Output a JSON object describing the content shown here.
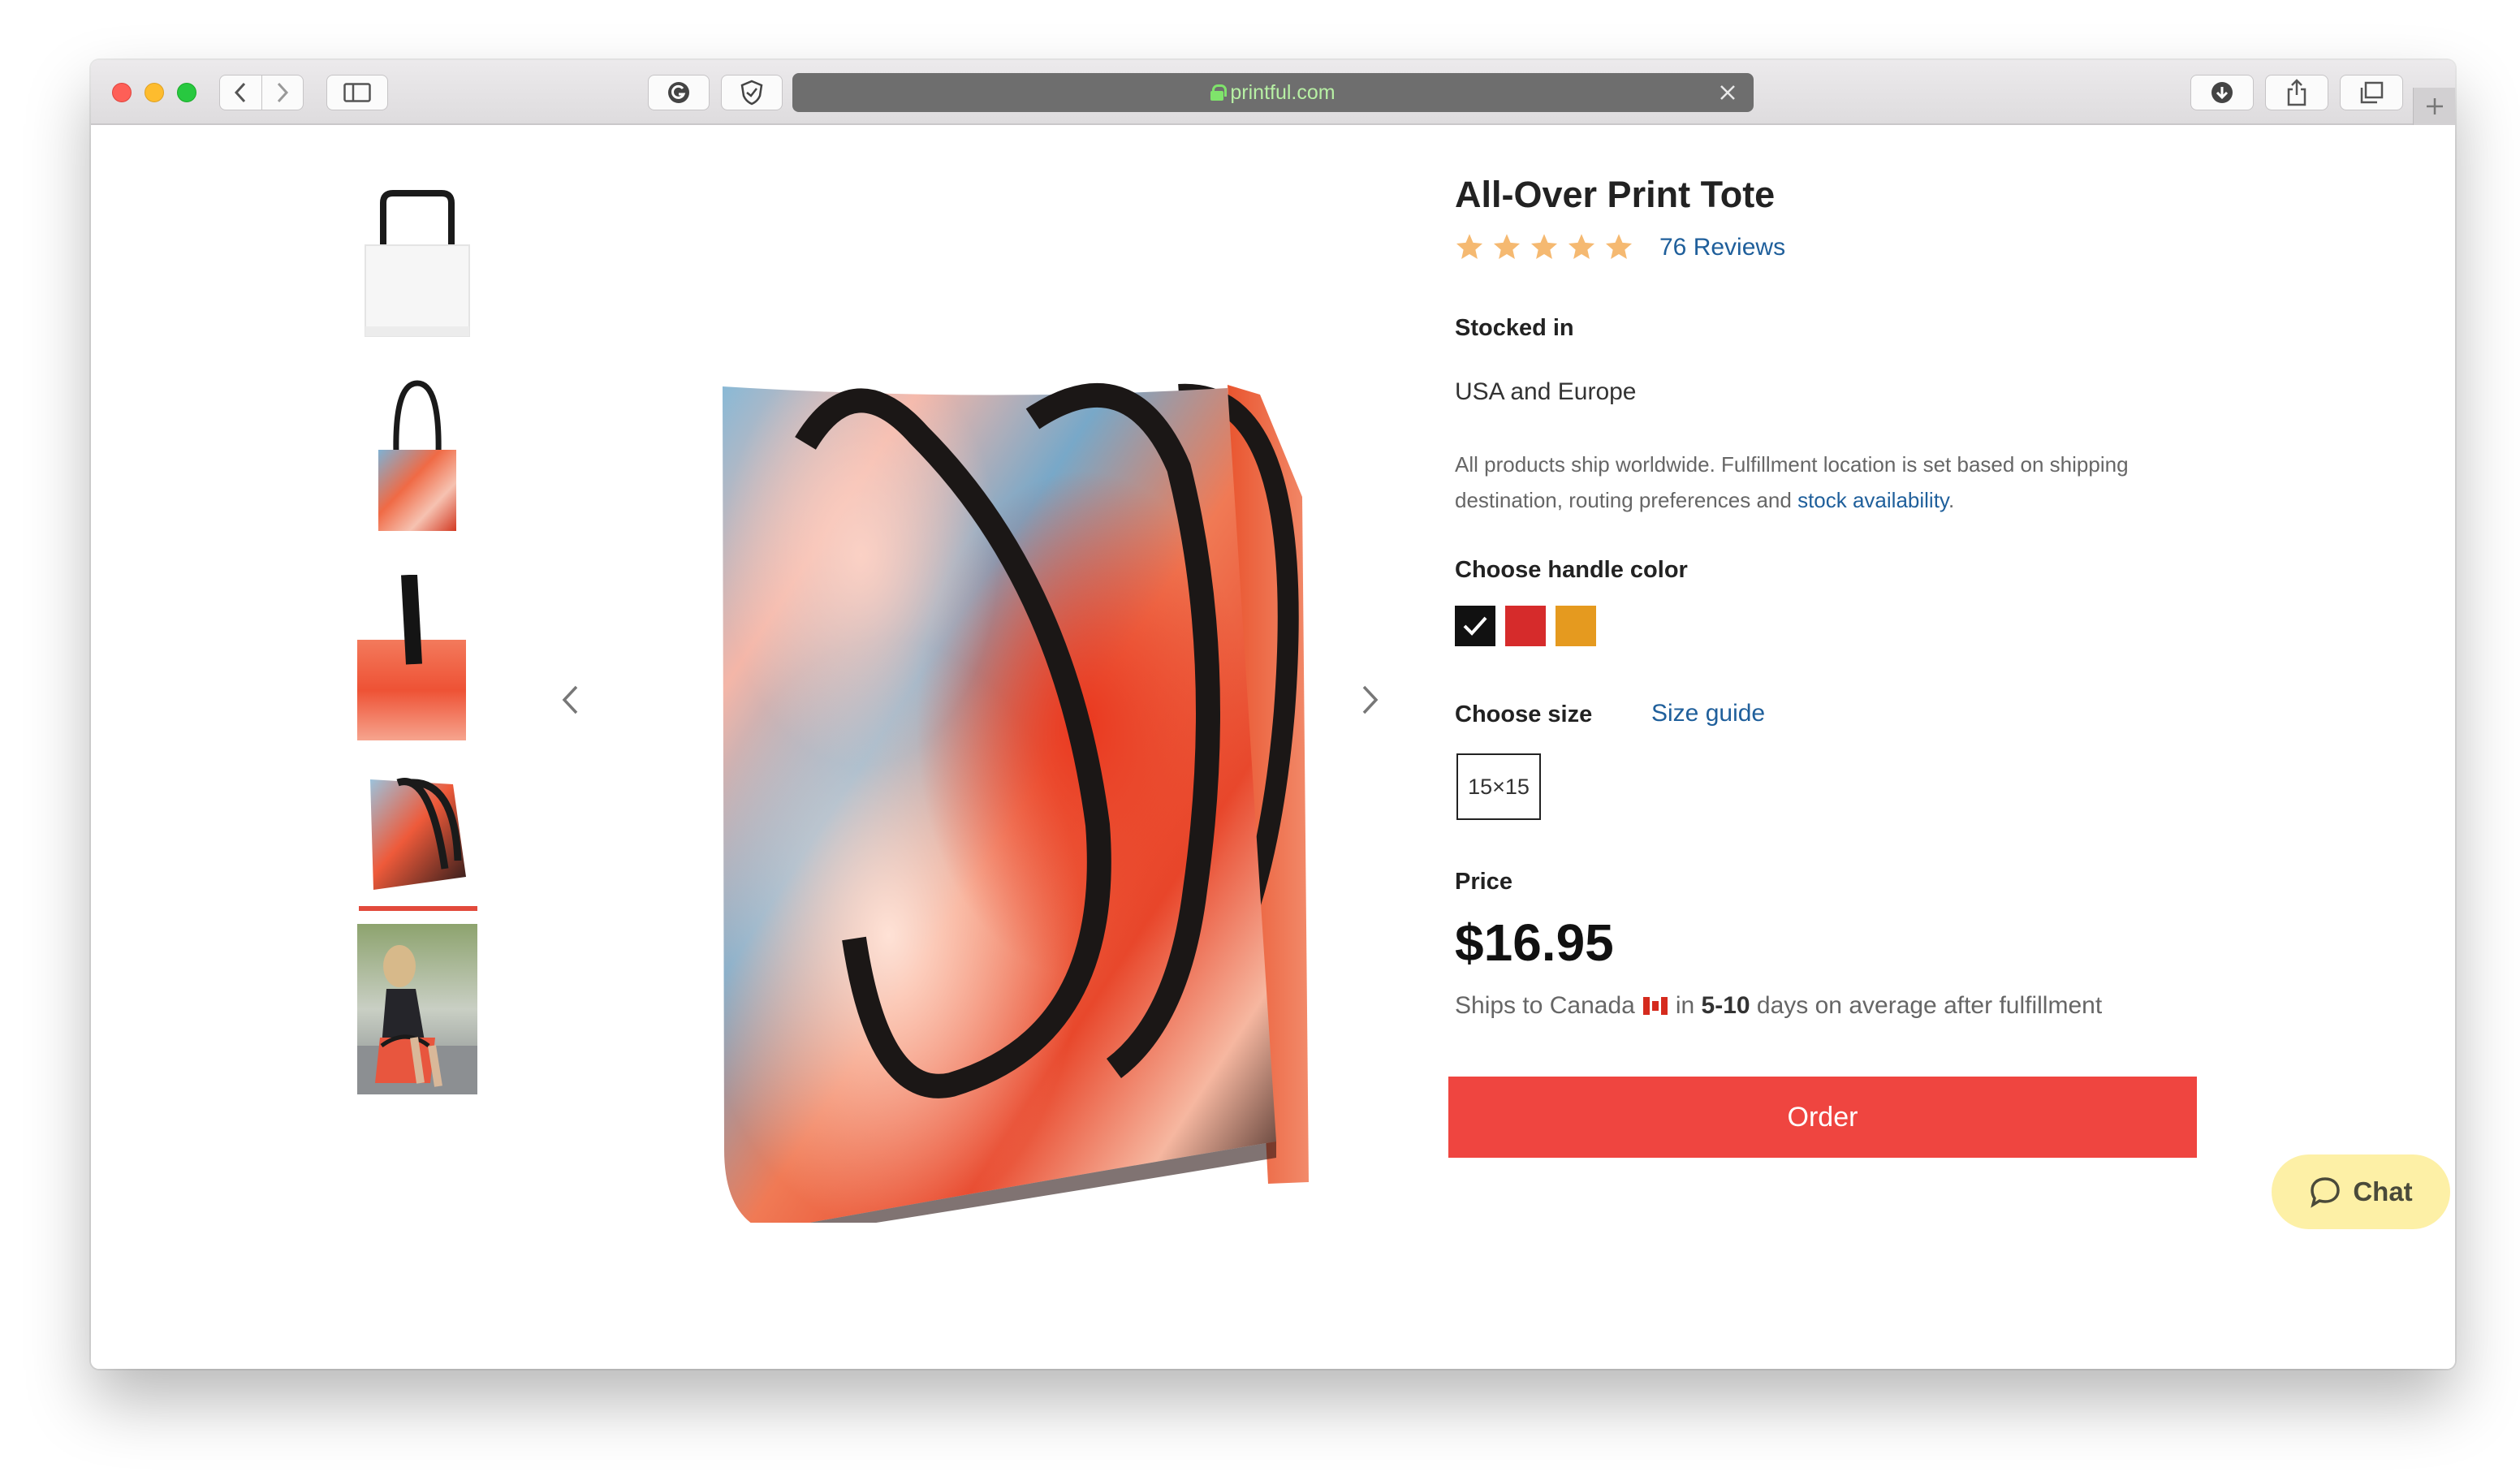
{
  "browser": {
    "url": "printful.com",
    "icons": {
      "back": "chevron-left-icon",
      "forward": "chevron-right-icon",
      "sidebar": "sidebar-icon",
      "extension1": "grammarly-icon",
      "extension2": "shield-icon",
      "download": "download-icon",
      "share": "share-icon",
      "tabs": "tabs-overview-icon",
      "new_tab": "plus-icon"
    }
  },
  "gallery": {
    "thumbnails": [
      {
        "name": "white-tote"
      },
      {
        "name": "cloud-tote-front"
      },
      {
        "name": "cloud-tote-handle-detail"
      },
      {
        "name": "cloud-tote-angle"
      },
      {
        "name": "model-with-tote"
      }
    ],
    "active_index": 3
  },
  "product": {
    "title": "All-Over Print Tote",
    "rating_stars": 5,
    "star_color": "#f5b971",
    "reviews": "76 Reviews",
    "stocked_label": "Stocked in",
    "stocked_value": "USA and Europe",
    "ship_note_text": "All products ship worldwide. Fulfillment location is set based on shipping destination, routing preferences and ",
    "ship_note_link": "stock availability",
    "ship_note_end": ".",
    "handle_label": "Choose handle color",
    "handle_colors": [
      {
        "name": "black",
        "hex": "#111111",
        "selected": true
      },
      {
        "name": "red",
        "hex": "#d62b2b",
        "selected": false
      },
      {
        "name": "yellow",
        "hex": "#e59a1f",
        "selected": false
      }
    ],
    "size_label": "Choose size",
    "size_guide": "Size guide",
    "size_option": "15×15",
    "price_label": "Price",
    "price": "$16.95",
    "ships_prefix": "Ships to Canada",
    "ships_in": "in",
    "ships_days": "5-10",
    "ships_suffix": "days on average after fulfillment",
    "order_label": "Order",
    "accent_color": "#ef4540"
  },
  "chat": {
    "label": "Chat"
  }
}
